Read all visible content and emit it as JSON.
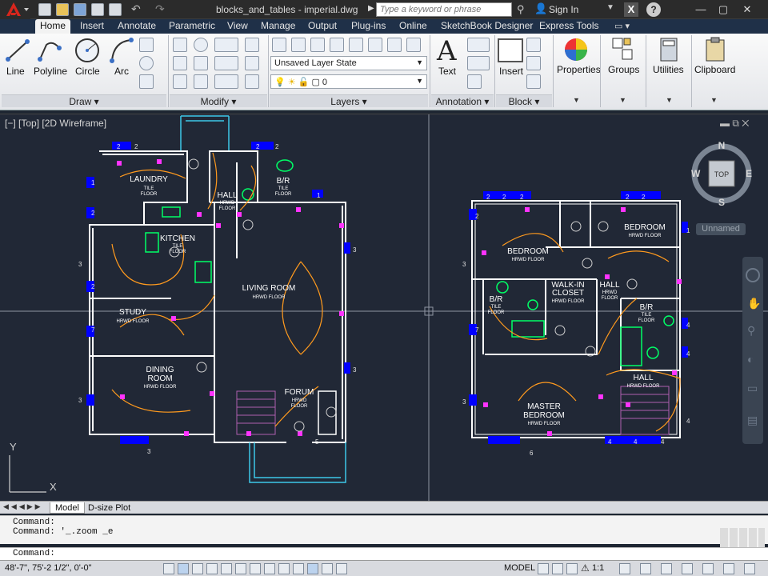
{
  "window": {
    "file_title": "blocks_and_tables - imperial.dwg",
    "search_placeholder": "Type a keyword or phrase",
    "sign_in": "Sign In"
  },
  "tabs": [
    "Home",
    "Insert",
    "Annotate",
    "Parametric",
    "View",
    "Manage",
    "Output",
    "Plug-ins",
    "Online",
    "SketchBook Designer",
    "Express Tools"
  ],
  "ribbon": {
    "draw": {
      "title": "Draw",
      "tools": [
        "Line",
        "Polyline",
        "Circle",
        "Arc"
      ]
    },
    "modify": {
      "title": "Modify"
    },
    "layers": {
      "title": "Layers",
      "layer_state": "Unsaved Layer State",
      "current_layer": "0"
    },
    "annotation": {
      "title": "Annotation",
      "text_label": "Text"
    },
    "block": {
      "title": "Block",
      "insert_label": "Insert"
    },
    "properties_label": "Properties",
    "groups_label": "Groups",
    "utilities_label": "Utilities",
    "clipboard_label": "Clipboard"
  },
  "viewport": {
    "label": "[−] [Top] [2D Wireframe]",
    "named_view": "Unnamed",
    "viewcube": {
      "north": "N",
      "south": "S",
      "east": "E",
      "west": "W",
      "face": "TOP"
    },
    "ucs": {
      "x": "X",
      "y": "Y"
    }
  },
  "plan_left": {
    "rooms": [
      {
        "name": "LAUNDRY",
        "floor": "TILE\nFLOOR"
      },
      {
        "name": "HALL",
        "floor": "HRWD\nFLOOR"
      },
      {
        "name": "B/R",
        "floor": "TILE\nFLOOR"
      },
      {
        "name": "KITCHEN",
        "floor": "TILE\nFLOOR"
      },
      {
        "name": "LIVING ROOM",
        "floor": "HRWD FLOOR"
      },
      {
        "name": "STUDY",
        "floor": "HRWD FLOOR"
      },
      {
        "name": "DINING\nROOM",
        "floor": "HRWD FLOOR"
      },
      {
        "name": "FORUM",
        "floor": "HRWD\nFLOOR"
      }
    ]
  },
  "plan_right": {
    "rooms": [
      {
        "name": "BEDROOM",
        "floor": "HRWD FLOOR"
      },
      {
        "name": "BEDROOM",
        "floor": "HRWD FLOOR"
      },
      {
        "name": "WALK-IN\nCLOSET",
        "floor": "HRWD FLOOR"
      },
      {
        "name": "HALL",
        "floor": "HRWD\nFLOOR"
      },
      {
        "name": "B/R",
        "floor": "TILE\nFLOOR"
      },
      {
        "name": "B/R",
        "floor": "TILE\nFLOOR"
      },
      {
        "name": "HALL",
        "floor": "HRWD FLOOR"
      },
      {
        "name": "MASTER\nBEDROOM",
        "floor": "HRWD FLOOR"
      }
    ]
  },
  "layout_tabs": [
    "Model",
    "D-size Plot"
  ],
  "command": {
    "history": [
      "Command:",
      "Command: '_.zoom _e"
    ],
    "prompt": "Command:"
  },
  "status": {
    "coords": "48'-7\",   75'-2 1/2\", 0'-0\"",
    "model": "MODEL",
    "scale": "1:1"
  },
  "colors": {
    "canvas": "#212836",
    "wall": "#ffffff",
    "wiring": "#ff9a1e",
    "fixture": "#00ff66",
    "outlet": "#ff33ff",
    "door": "#5b8fd6",
    "tag": "#0000ff",
    "porch": "#3ec8e8"
  }
}
